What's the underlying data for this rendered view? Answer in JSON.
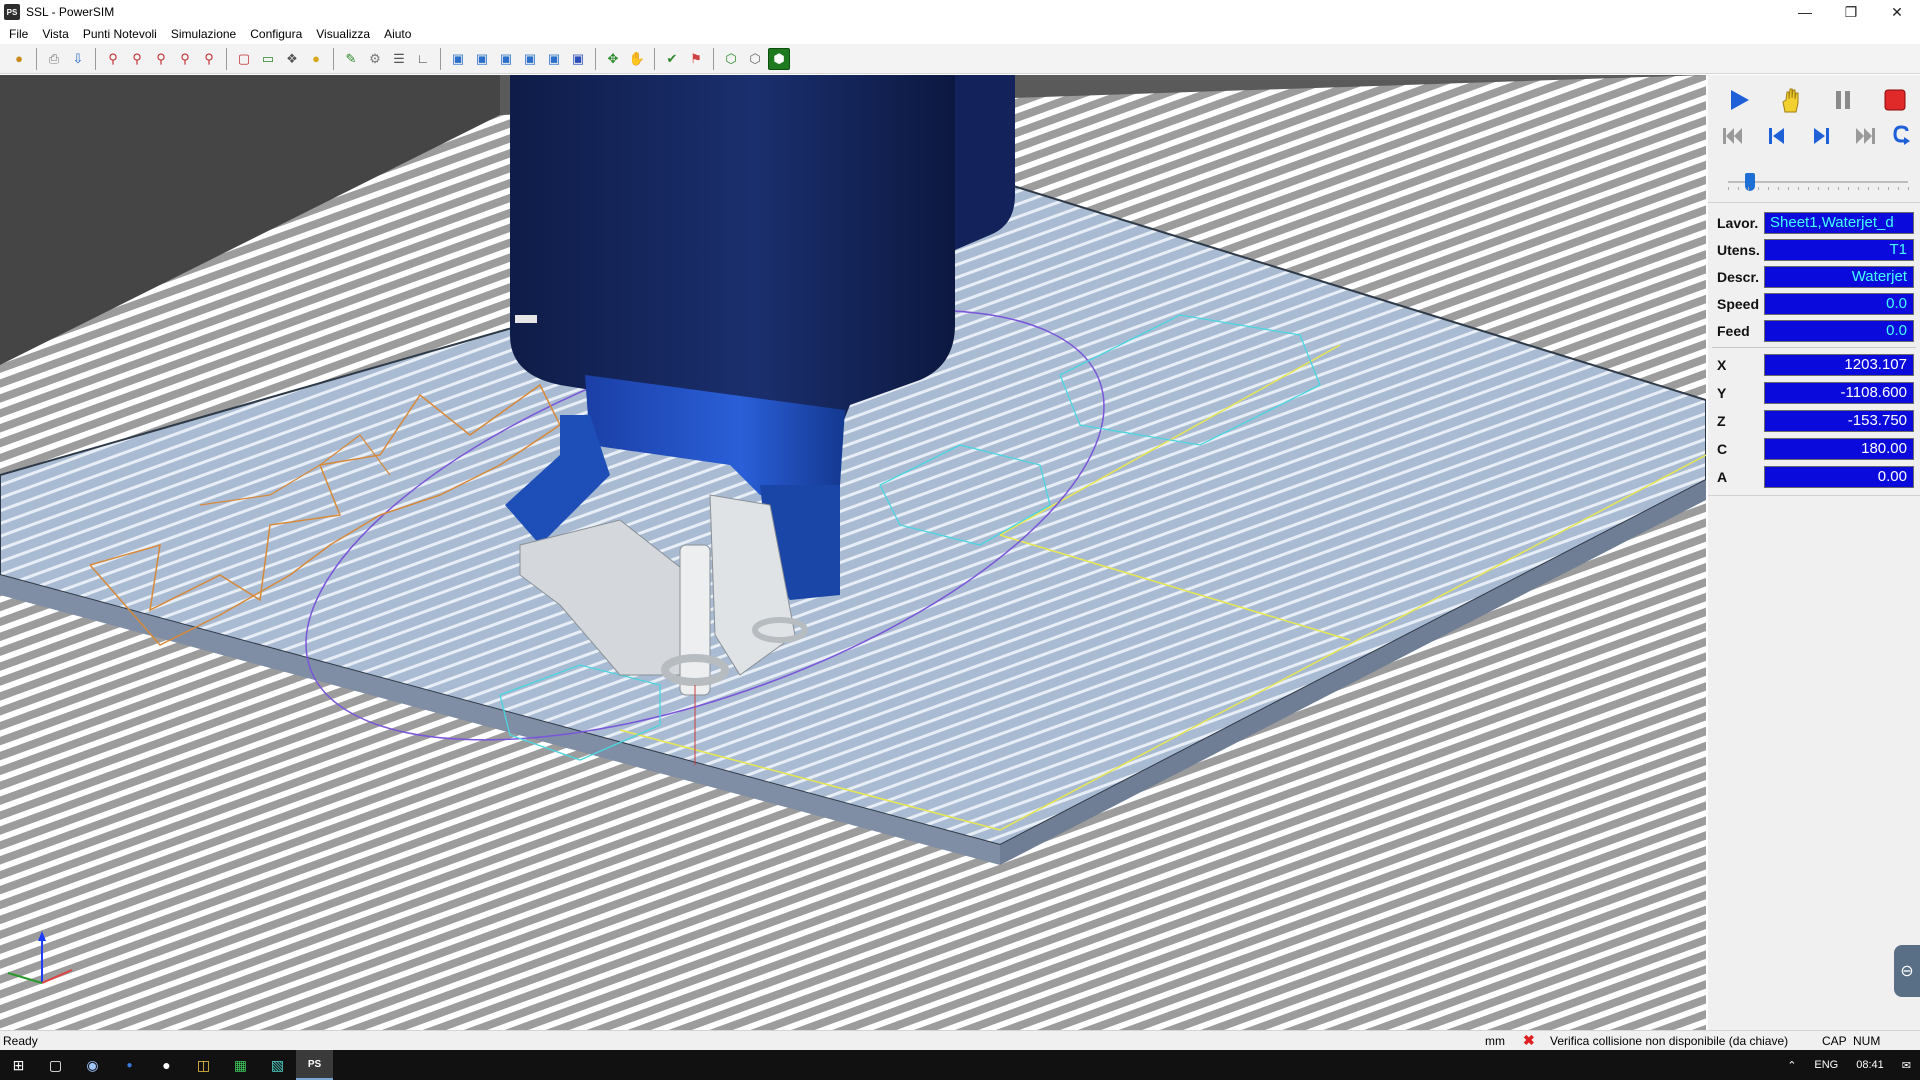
{
  "window": {
    "app_icon": "PS",
    "title": "SSL - PowerSIM",
    "controls": [
      "minimize-icon",
      "restore-icon",
      "close-icon"
    ]
  },
  "menu": [
    "File",
    "Vista",
    "Punti Notevoli",
    "Simulazione",
    "Configura",
    "Visualizza",
    "Aiuto"
  ],
  "toolbar": {
    "groups": [
      [
        "open-icon",
        "print-icon",
        "import-icon"
      ],
      [
        "zoom-in-icon",
        "zoom-window-icon",
        "zoom-out-icon",
        "zoom-previous-icon",
        "zoom-extents-icon",
        "zoom-all-icon"
      ],
      [
        "screen-icon",
        "select-icon",
        "light-icon"
      ],
      [
        "tool-icon",
        "machine-icon",
        "list-icon",
        "axes-icon"
      ],
      [
        "view-iso-icon",
        "view-front-icon",
        "view-side-icon",
        "view-back-icon",
        "view-top-icon",
        "view-bottom-icon"
      ],
      [
        "move-icon",
        "hand-icon"
      ],
      [
        "check-icon",
        "flag-icon"
      ],
      [
        "solid-icon",
        "wire-icon",
        "shaded-icon"
      ]
    ],
    "active": "shaded-icon"
  },
  "simulation": {
    "play": "play-icon",
    "hand": "hand-icon",
    "pause": "pause-icon",
    "stop": "stop-icon",
    "first": "skip-first-icon",
    "prev": "step-back-icon",
    "next": "step-forward-icon",
    "last": "skip-last-icon",
    "loop": "loop-icon",
    "speed_level": 0.1
  },
  "info": {
    "lavor_label": "Lavor.",
    "lavor_value": "Sheet1,Waterjet_d",
    "utens_label": "Utens.",
    "utens_value": "T1",
    "descr_label": "Descr.",
    "descr_value": "Waterjet",
    "speed_label": "Speed",
    "speed_value": "0.0",
    "feed_label": "Feed",
    "feed_value": "0.0"
  },
  "coords": {
    "x_label": "X",
    "x_value": "1203.107",
    "y_label": "Y",
    "y_value": "-1108.600",
    "z_label": "Z",
    "z_value": "-153.750",
    "c_label": "C",
    "c_value": "180.00",
    "a_label": "A",
    "a_value": "0.00"
  },
  "colors": {
    "value_bg": "#0a0adc",
    "value_text": "#44ffff",
    "coord_text": "#ffffff",
    "machine_dark": "#1a2a5c",
    "machine_blue": "#1e4fb8",
    "star_path": "#d7893a",
    "ellipse_path": "#7a55d9",
    "hex_path": "#49d6e0",
    "sheet_outline": "#e7e650"
  },
  "status": {
    "ready": "Ready",
    "units": "mm",
    "message": "Verifica collisione non disponibile (da chiave)",
    "cap": "CAP",
    "num": "NUM"
  },
  "taskbar": {
    "items": [
      "start-icon",
      "task-view-icon",
      "browser-icon",
      "app-icon",
      "chat-icon",
      "explorer-icon",
      "excel-icon",
      "xml-icon",
      "powersim-icon"
    ],
    "lang": "ENG",
    "time": "08:41"
  }
}
